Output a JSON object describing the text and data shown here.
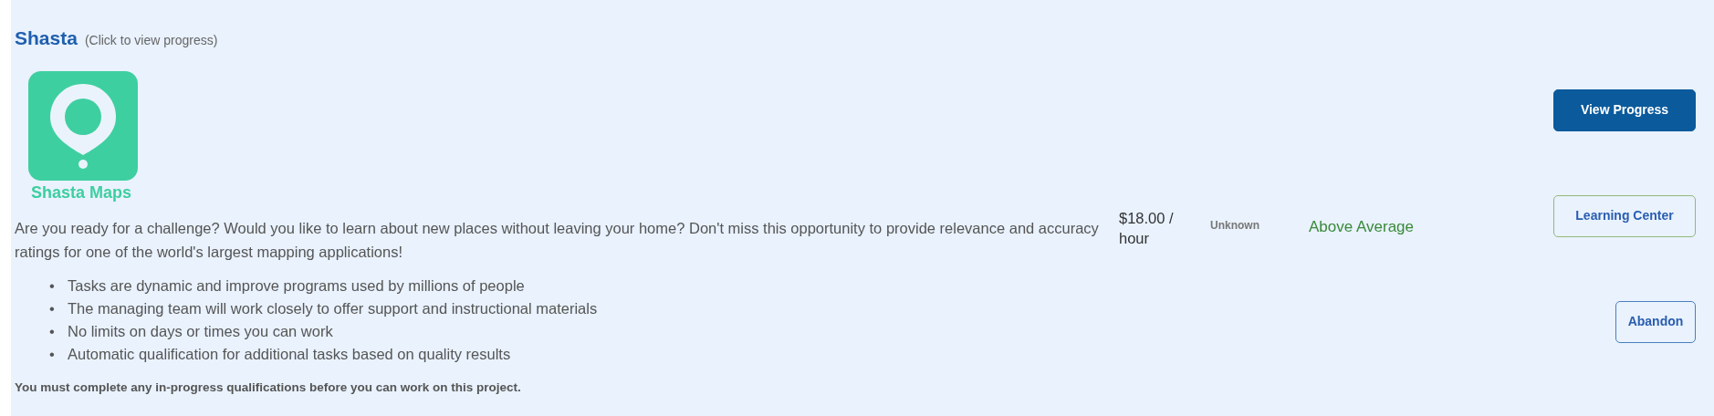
{
  "project": {
    "title": "Shasta",
    "hint": "(Click to view progress)",
    "logo_caption": "Shasta Maps",
    "description": "Are you ready for a challenge? Would you like to learn about new places without leaving your home? Don't miss this opportunity to provide relevance and accuracy ratings for one of the world's largest mapping applications!",
    "bullets": [
      {
        "marker": "•",
        "text": "Tasks are dynamic and improve programs used by millions of people"
      },
      {
        "marker": "•",
        "text": "The managing team will work closely to offer support and instructional materials"
      },
      {
        "marker": "•",
        "text": "No limits on days or times you can work"
      },
      {
        "marker": "•",
        "text": "Automatic qualification for additional tasks based on quality results"
      }
    ],
    "note": "You must complete any in-progress qualifications before you can work on this project.",
    "rate": "$18.00 / hour",
    "column_2": "Unknown",
    "rating": "Above Average",
    "buttons": [
      {
        "label": "View Progress",
        "kind": "primary"
      },
      {
        "label": "Learning Center",
        "kind": "outline-green"
      },
      {
        "label": "Abandon",
        "kind": "outline-blue"
      }
    ]
  }
}
